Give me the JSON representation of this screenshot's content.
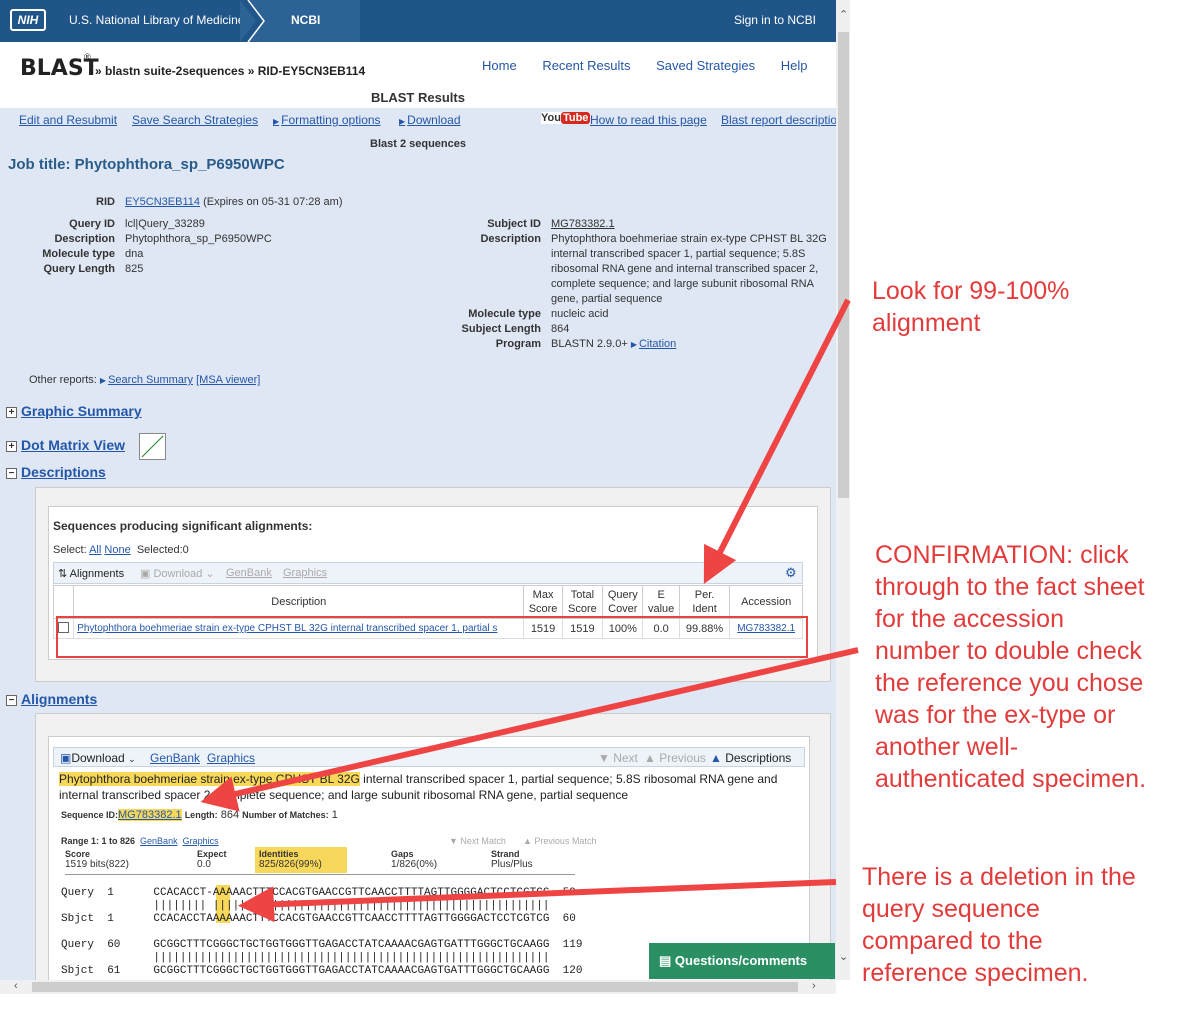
{
  "topbar": {
    "nih_badge": "NIH",
    "library": "U.S. National Library of Medicine",
    "ncbi": "NCBI",
    "signin": "Sign in to NCBI"
  },
  "header": {
    "logo": "BLAST",
    "logo_mark": "®",
    "breadcrumb": "» blastn suite-2sequences » RID-EY5CN3EB114",
    "nav": [
      "Home",
      "Recent Results",
      "Saved Strategies",
      "Help"
    ]
  },
  "results_title": "BLAST Results",
  "toolbar": {
    "edit": "Edit and Resubmit",
    "save": "Save Search Strategies",
    "formatting": "Formatting options",
    "download": "Download",
    "youtube_you": "You",
    "youtube_tube": "Tube",
    "how_to": "How to read this page",
    "report_desc": "Blast report descriptio"
  },
  "subtitle": "Blast 2 sequences",
  "job_title": "Job title: Phytophthora_sp_P6950WPC",
  "info": {
    "rid_label": "RID",
    "rid_value": "EY5CN3EB114",
    "rid_expiry": "(Expires on 05-31 07:28 am)",
    "query_id_label": "Query ID",
    "query_id": "lcl|Query_33289",
    "description_label": "Description",
    "description": "Phytophthora_sp_P6950WPC",
    "molecule_type_label": "Molecule type",
    "molecule_type": "dna",
    "query_length_label": "Query Length",
    "query_length": "825",
    "subject_id_label": "Subject ID",
    "subject_id": "MG783382.1",
    "subject_description_label": "Description",
    "subject_description": "Phytophthora boehmeriae strain ex-type CPHST BL 32G internal transcribed spacer 1, partial sequence; 5.8S ribosomal RNA gene and internal transcribed spacer 2, complete sequence; and large subunit ribosomal RNA gene, partial sequence",
    "subject_molecule_type_label": "Molecule type",
    "subject_molecule_type": "nucleic acid",
    "subject_length_label": "Subject Length",
    "subject_length": "864",
    "program_label": "Program",
    "program": "BLASTN 2.9.0+",
    "citation": "Citation"
  },
  "other_reports": {
    "label": "Other reports:",
    "search_summary": "Search Summary",
    "msa": "[MSA viewer]"
  },
  "sections": {
    "graphic_summary": "Graphic Summary",
    "dot_matrix": "Dot Matrix View",
    "descriptions": "Descriptions",
    "alignments": "Alignments"
  },
  "descriptions_panel": {
    "heading": "Sequences producing significant alignments:",
    "select_label": "Select:",
    "all": "All",
    "none": "None",
    "selected": "Selected:0",
    "tb_alignments": "Alignments",
    "tb_download": "Download",
    "tb_genbank": "GenBank",
    "tb_graphics": "Graphics",
    "columns": [
      "Description",
      "Max Score",
      "Total Score",
      "Query Cover",
      "E value",
      "Per. Ident",
      "Accession"
    ],
    "row": {
      "description": "Phytophthora boehmeriae strain ex-type CPHST BL 32G internal transcribed spacer 1, partial s",
      "max_score": "1519",
      "total_score": "1519",
      "query_cover": "100%",
      "e_value": "0.0",
      "per_ident": "99.88%",
      "accession": "MG783382.1"
    }
  },
  "alignments_panel": {
    "tb_download": "Download",
    "tb_genbank": "GenBank",
    "tb_graphics": "Graphics",
    "tb_next": "Next",
    "tb_previous": "Previous",
    "tb_descriptions": "Descriptions",
    "hit_title_hl": "Phytophthora boehmeriae strain ex-type CPHST BL 32G",
    "hit_title_rest": " internal transcribed spacer 1, partial sequence; 5.8S ribosomal RNA gene and internal transcribed spacer 2, complete sequence; and large subunit ribosomal RNA gene, partial sequence",
    "seqid_label": "Sequence ID:",
    "seqid": "MG783382.1",
    "length_label": "Length:",
    "length": "864",
    "matches_label": "Number of Matches:",
    "matches": "1",
    "range": "Range 1: 1 to 826",
    "range_genbank": "GenBank",
    "range_graphics": "Graphics",
    "next_match": "Next Match",
    "prev_match": "Previous Match",
    "stats": {
      "score_h": "Score",
      "score": "1519 bits(822)",
      "expect_h": "Expect",
      "expect": "0.0",
      "identities_h": "Identities",
      "identities": "825/826(99%)",
      "gaps_h": "Gaps",
      "gaps": "1/826(0%)",
      "strand_h": "Strand",
      "strand": "Plus/Plus"
    },
    "alignment_lines": [
      "Query  1      CCACACCT-AAAAACTTTCCACGTGAACCGTTCAACCTTTTAGTTGGGGACTCCTCGTCG  59",
      "              |||||||| |||||||||||||||||||||||||||||||||||||||||||||||||||",
      "Sbjct  1      CCACACCTAAAAAACTTTCCACGTGAACCGTTCAACCTTTTAGTTGGGGACTCCTCGTCG  60",
      "",
      "Query  60     GCGGCTTTCGGGCTGCTGGTGGGTTGAGACCTATCAAAACGAGTGATTTGGGCTGCAAGG  119",
      "              ||||||||||||||||||||||||||||||||||||||||||||||||||||||||||||",
      "Sbjct  61     GCGGCTTTCGGGCTGCTGGTGGGTTGAGACCTATCAAAACGAGTGATTTGGGCTGCAAGG  120"
    ]
  },
  "questions_button": "Questions/comments",
  "annotations": {
    "note1": "Look for 99-100%\nalignment",
    "note2": "CONFIRMATION: click\nthrough to the fact sheet\nfor the accession\nnumber to double check\nthe reference you chose\nwas for the ex-type or\nanother well-\nauthenticated specimen.",
    "note3": "There is a deletion in the\nquery sequence\ncompared to the\nreference specimen.",
    "color": "#e23b3b"
  }
}
